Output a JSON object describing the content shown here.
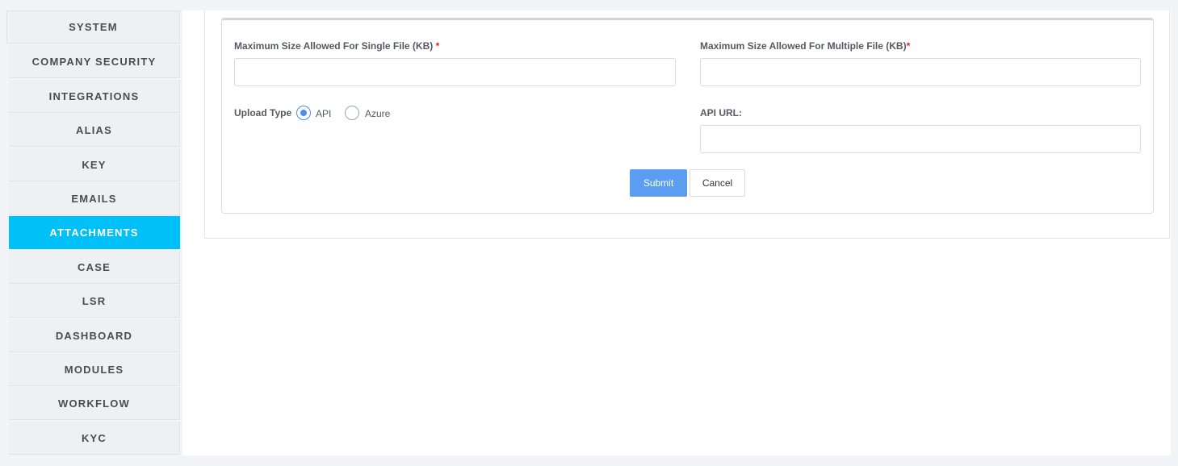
{
  "sidebar": {
    "items": [
      {
        "label": "SYSTEM",
        "active": false
      },
      {
        "label": "COMPANY SECURITY",
        "active": false
      },
      {
        "label": "INTEGRATIONS",
        "active": false
      },
      {
        "label": "ALIAS",
        "active": false
      },
      {
        "label": "KEY",
        "active": false
      },
      {
        "label": "EMAILS",
        "active": false
      },
      {
        "label": "ATTACHMENTS",
        "active": true
      },
      {
        "label": "CASE",
        "active": false
      },
      {
        "label": "LSR",
        "active": false
      },
      {
        "label": "DASHBOARD",
        "active": false
      },
      {
        "label": "MODULES",
        "active": false
      },
      {
        "label": "WORKFLOW",
        "active": false
      },
      {
        "label": "KYC",
        "active": false
      }
    ]
  },
  "form": {
    "single_file_label": "Maximum Size Allowed For Single File (KB)",
    "single_file_value": "",
    "multiple_file_label": "Maximum Size Allowed For Multiple File (KB)",
    "multiple_file_value": "",
    "required_mark": "*",
    "upload_type_label": "Upload Type",
    "upload_options": [
      {
        "label": "API",
        "checked": true
      },
      {
        "label": "Azure",
        "checked": false
      }
    ],
    "api_url_label": "API URL:",
    "api_url_value": "",
    "submit_label": "Submit",
    "cancel_label": "Cancel"
  },
  "colors": {
    "accent": "#00c0f8",
    "submit": "#5b9df0",
    "required": "#e01e1e"
  }
}
